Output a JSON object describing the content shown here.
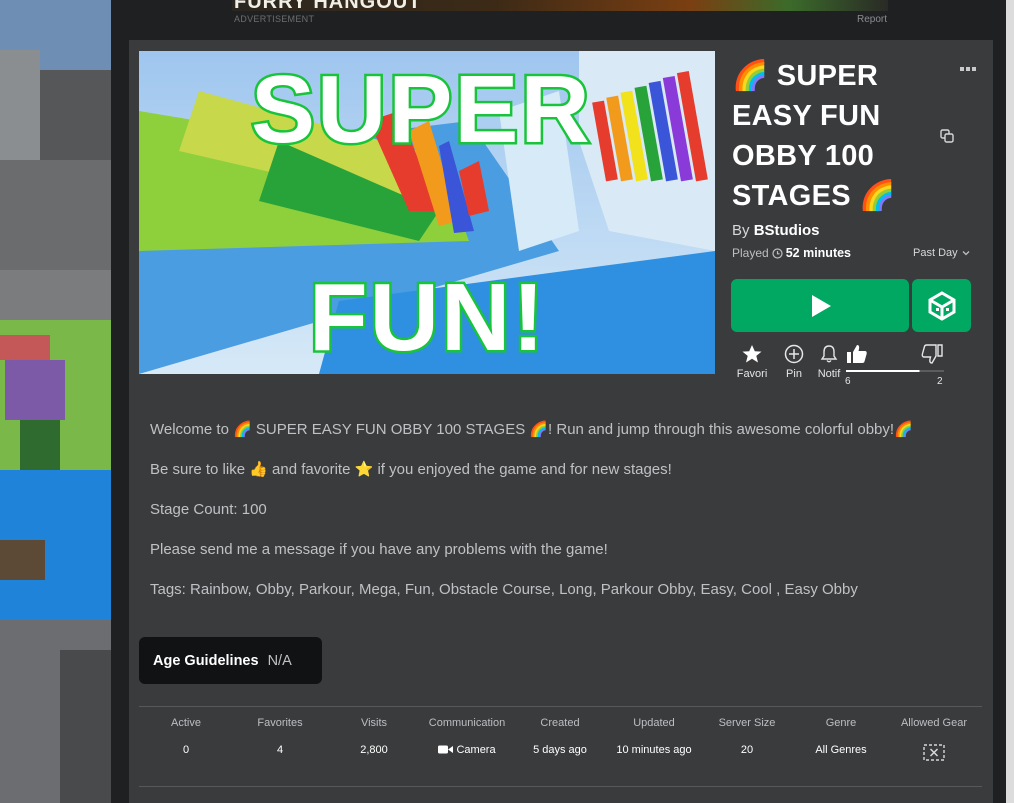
{
  "ad": {
    "banner_text": "FURRY HANGOUT",
    "label": "ADVERTISEMENT",
    "report_label": "Report"
  },
  "thumbnail": {
    "line1": "SUPER",
    "line2": "FUN!"
  },
  "game": {
    "title": "🌈 SUPER EASY FUN OBBY 100 STAGES 🌈",
    "by_prefix": "By",
    "creator": "BStudios",
    "played_label": "Played",
    "played_value": "52 minutes",
    "period": "Past Day"
  },
  "actions": {
    "favorite": "Favori",
    "pin": "Pin",
    "notify": "Notif",
    "upvotes": "6",
    "downvotes": "2",
    "upvote_fraction": 0.75
  },
  "description": [
    "Welcome to 🌈 SUPER EASY FUN OBBY 100 STAGES 🌈! Run and jump through this awesome colorful obby!🌈",
    "Be sure to like 👍 and favorite ⭐ if you enjoyed the game and for new stages!",
    "Stage Count: 100",
    "Please send me a message if you have any problems with the game!",
    "Tags: Rainbow, Obby, Parkour, Mega, Fun, Obstacle Course, Long, Parkour Obby, Easy, Cool , Easy Obby"
  ],
  "age_guidelines": {
    "label": "Age Guidelines",
    "value": "N/A"
  },
  "stats": [
    {
      "header": "Active",
      "value": "0"
    },
    {
      "header": "Favorites",
      "value": "4"
    },
    {
      "header": "Visits",
      "value": "2,800"
    },
    {
      "header": "Communication",
      "value": "Camera",
      "icon": "camera-icon"
    },
    {
      "header": "Created",
      "value": "5 days ago"
    },
    {
      "header": "Updated",
      "value": "10 minutes ago"
    },
    {
      "header": "Server Size",
      "value": "20"
    },
    {
      "header": "Genre",
      "value": "All Genres"
    },
    {
      "header": "Allowed Gear",
      "value": "",
      "icon": "no-gear-icon"
    }
  ],
  "colors": {
    "accent_green": "#00a862",
    "panel": "#393b3d",
    "thumb_outline": "#18c43a"
  },
  "icons": [
    "more-options-icon",
    "copy-icon",
    "clock-icon",
    "chevron-down-icon",
    "play-icon",
    "studio-icon",
    "star-icon",
    "pin-icon",
    "bell-icon",
    "thumbs-up-icon",
    "thumbs-down-icon"
  ]
}
